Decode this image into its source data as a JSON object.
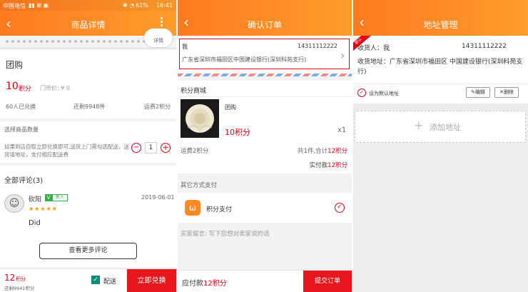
{
  "p1": {
    "status": {
      "carrier": "中国电信",
      "battery": "61%",
      "time": "16:41"
    },
    "header_title": "商品详情",
    "detail_badge": "详情",
    "product_name": "团购",
    "price_value": "10",
    "price_unit": "积分",
    "market_price": "门市价: ¥ 0",
    "exchanged": "60人已兑换",
    "remaining": "还剩9948件",
    "shipping": "运费2积分",
    "select_qty_label": "选择商品数量",
    "qty_note": "如果到店自取立即兑换即可,送货上门需勾选配送，送货填地址，支付相应配送费",
    "quantity": "1",
    "minus": "−",
    "plus": "+",
    "reviews_title": "全部评论(3)",
    "review": {
      "user": "砍阳",
      "level": "V",
      "badge": "新人",
      "date": "2019-06-01",
      "stars": "★★★★★",
      "text": "Did"
    },
    "more_reviews": "查看更多评论",
    "footer": {
      "price": "12",
      "unit": "积分",
      "stock": "还剩9941积分",
      "deliver_label": "配送",
      "buy_button": "立即兑换"
    }
  },
  "p2": {
    "header_title": "确认订单",
    "address": {
      "name": "我",
      "phone": "14311112222",
      "detail": "广东省深圳市福田区中国建设银行(深圳科苑支行)"
    },
    "shop": "积分商城",
    "item": {
      "name": "团购",
      "price": "10积分",
      "qty": "x1"
    },
    "shipping_left": "运费2积分",
    "summary_prefix": "共1件,合计",
    "summary_value": "12积分",
    "paid_prefix": "实付款",
    "paid_value": "12积分",
    "other_pay": "其它方式支付",
    "pay_method": "积分支付",
    "message_placeholder": "买家留言: 写下您想对卖家说的话",
    "footer": {
      "label": "应付款",
      "value": "12积分",
      "submit": "提交订单"
    }
  },
  "p3": {
    "header_title": "地址管理",
    "default_ribbon": "默认",
    "receiver": "收货人：我",
    "phone": "14311112222",
    "address": "收货地址：广东省深圳市福田区    中国建设银行(深圳科苑支行)",
    "set_default": "设为默认地址",
    "edit": "编辑",
    "delete": "删除",
    "add_address": "添加地址"
  },
  "colors": {
    "brand": "#ff8a24",
    "price": "#e60012",
    "check": "#0c8c78"
  }
}
